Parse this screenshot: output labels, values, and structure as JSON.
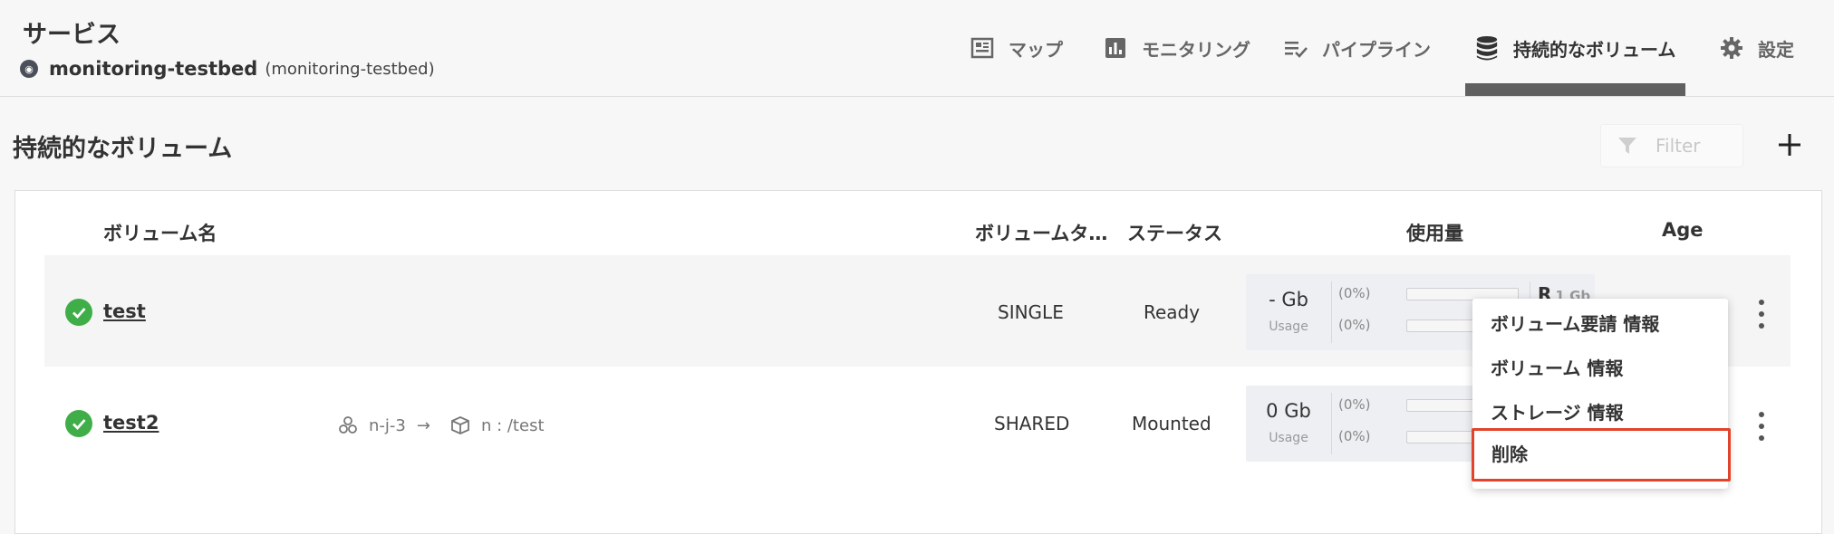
{
  "header": {
    "title": "サービス",
    "service_name": "monitoring-testbed",
    "service_namespace": "(monitoring-testbed)"
  },
  "nav": {
    "items": [
      {
        "label": "マップ",
        "icon": "map-icon"
      },
      {
        "label": "モニタリング",
        "icon": "bar-chart-icon"
      },
      {
        "label": "パイプライン",
        "icon": "pipeline-icon"
      },
      {
        "label": "持続的なボリューム",
        "icon": "database-icon",
        "active": true
      },
      {
        "label": "設定",
        "icon": "gear-icon"
      }
    ]
  },
  "page": {
    "title": "持続的なボリューム",
    "filter_placeholder": "Filter",
    "add_label": "+"
  },
  "table": {
    "headers": [
      "ボリューム名",
      "ボリュームタ…",
      "ステータス",
      "使用量",
      "Age"
    ],
    "rows": [
      {
        "name": "test",
        "status_icon": "check-circle-icon",
        "type": "SINGLE",
        "status": "Ready",
        "usage": {
          "value": "- Gb",
          "label": "Usage",
          "pct1": "(0%)",
          "pct2": "(0%)",
          "cap_prefix": "R",
          "cap": "1 Gb"
        }
      },
      {
        "name": "test2",
        "status_icon": "check-circle-icon",
        "node": "n-j-3",
        "arrow": "→",
        "mount": "n : /test",
        "type": "SHARED",
        "status": "Mounted",
        "usage": {
          "value": "0 Gb",
          "label": "Usage",
          "pct1": "(0%)",
          "pct2": "(0%)"
        }
      }
    ]
  },
  "context_menu": {
    "items": [
      "ボリューム要請 情報",
      "ボリューム 情報",
      "ストレージ 情報",
      "削除"
    ]
  },
  "colors": {
    "accent_success": "#3fae49",
    "highlight": "#e2432a",
    "nav_underline": "#606060"
  }
}
